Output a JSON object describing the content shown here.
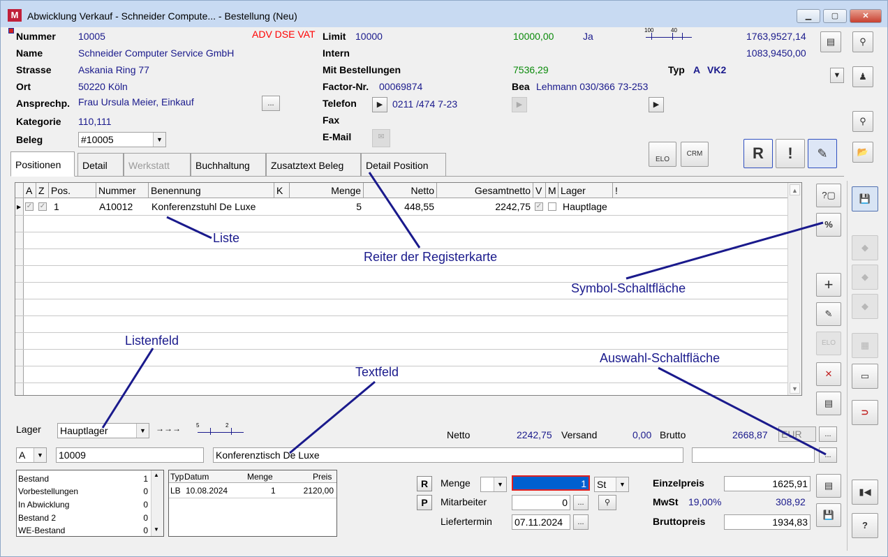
{
  "window": {
    "title": "Abwicklung Verkauf - Schneider Compute... - Bestellung (Neu)",
    "app_icon": "M"
  },
  "header": {
    "nummer_label": "Nummer",
    "nummer": "10005",
    "flags": "ADV DSE VAT",
    "name_label": "Name",
    "name": "Schneider Computer Service GmbH",
    "strasse_label": "Strasse",
    "strasse": "Askania Ring 77",
    "ort_label": "Ort",
    "ort": "50220 Köln",
    "ansprech_label": "Ansprechp.",
    "ansprech": "Frau Ursula Meier, Einkauf",
    "kategorie_label": "Kategorie",
    "kategorie": "110,111",
    "beleg_label": "Beleg",
    "beleg": "#10005",
    "limit_label": "Limit",
    "limit": "10000",
    "limit_value": "10000,00",
    "ja": "Ja",
    "intern_label": "Intern",
    "mitbest_label": "Mit Bestellungen",
    "mitbest_value": "7536,29",
    "factor_label": "Factor-Nr.",
    "factor": "00069874",
    "bea_label": "Bea",
    "bea": "Lehmann 030/366 73-253",
    "telefon_label": "Telefon",
    "telefon": "0211 /474 7-23",
    "fax_label": "Fax",
    "email_label": "E-Mail",
    "typ_label": "Typ",
    "typ": "A",
    "typ2": "VK2",
    "amount1": "1763,9527,14",
    "amount2": "1083,9450,00",
    "scale_a": "100",
    "scale_b": "40",
    "ellipsis": "..."
  },
  "tabs": [
    {
      "label": "Positionen"
    },
    {
      "label": "Detail"
    },
    {
      "label": "Werkstatt"
    },
    {
      "label": "Buchhaltung"
    },
    {
      "label": "Zusatztext Beleg"
    },
    {
      "label": "Detail Position"
    }
  ],
  "grid": {
    "columns": [
      "A",
      "Z",
      "Pos.",
      "Nummer",
      "Benennung",
      "K",
      "Menge",
      "Netto",
      "Gesamtnetto",
      "V",
      "M",
      "Lager",
      "!"
    ],
    "row": {
      "pos": "1",
      "nummer": "A10012",
      "benennung": "Konferenzstuhl De Luxe",
      "menge": "5",
      "netto": "448,55",
      "gesamtnetto": "2242,75",
      "lager": "Hauptlage"
    }
  },
  "annotations": {
    "liste": "Liste",
    "reiter": "Reiter der Registerkarte",
    "symbol": "Symbol-Schaltfläche",
    "listenfeld": "Listenfeld",
    "textfeld": "Textfeld",
    "auswahl": "Auswahl-Schaltfläche"
  },
  "lower": {
    "lager_label": "Lager",
    "lager": "Hauptlager",
    "netto_label": "Netto",
    "netto": "2242,75",
    "versand_label": "Versand",
    "versand": "0,00",
    "brutto_label": "Brutto",
    "brutto": "2668,87",
    "currency": "EUR",
    "kind": "A",
    "artnr": "10009",
    "artname": "Konferenztisch De Luxe",
    "scale_a": "5",
    "scale_b": "2"
  },
  "stock": [
    {
      "label": "Bestand",
      "value": "1"
    },
    {
      "label": "Vorbestellungen",
      "value": "0"
    },
    {
      "label": "In Abwicklung",
      "value": "0"
    },
    {
      "label": "Bestand 2",
      "value": "0"
    },
    {
      "label": "WE-Bestand",
      "value": "0"
    }
  ],
  "history": {
    "cols": [
      "Typ",
      "Datum",
      "Menge",
      "Preis"
    ],
    "row": {
      "typ": "LB",
      "datum": "10.08.2024",
      "menge": "1",
      "preis": "2120,00"
    }
  },
  "order": {
    "r": "R",
    "p": "P",
    "menge_label": "Menge",
    "menge": "1",
    "unit": "St",
    "mitarbeiter_label": "Mitarbeiter",
    "mitarbeiter": "0",
    "liefer_label": "Liefertermin",
    "liefer": "07.11.2024",
    "einzel_label": "Einzelpreis",
    "einzel": "1625,91",
    "mwst_label": "MwSt",
    "mwst_rate": "19,00%",
    "mwst": "308,92",
    "brutto_label": "Bruttopreis",
    "brutto": "1934,83"
  },
  "buttons": {
    "elo": "ELO",
    "crm": "CRM",
    "r": "R",
    "excl": "!",
    "plus": "+",
    "percent": "%",
    "help": "?"
  },
  "colors": {
    "accent": "#1a1a8c",
    "flag": "#ff0000",
    "green": "#0a8a0a",
    "selected": "#0060d0"
  }
}
